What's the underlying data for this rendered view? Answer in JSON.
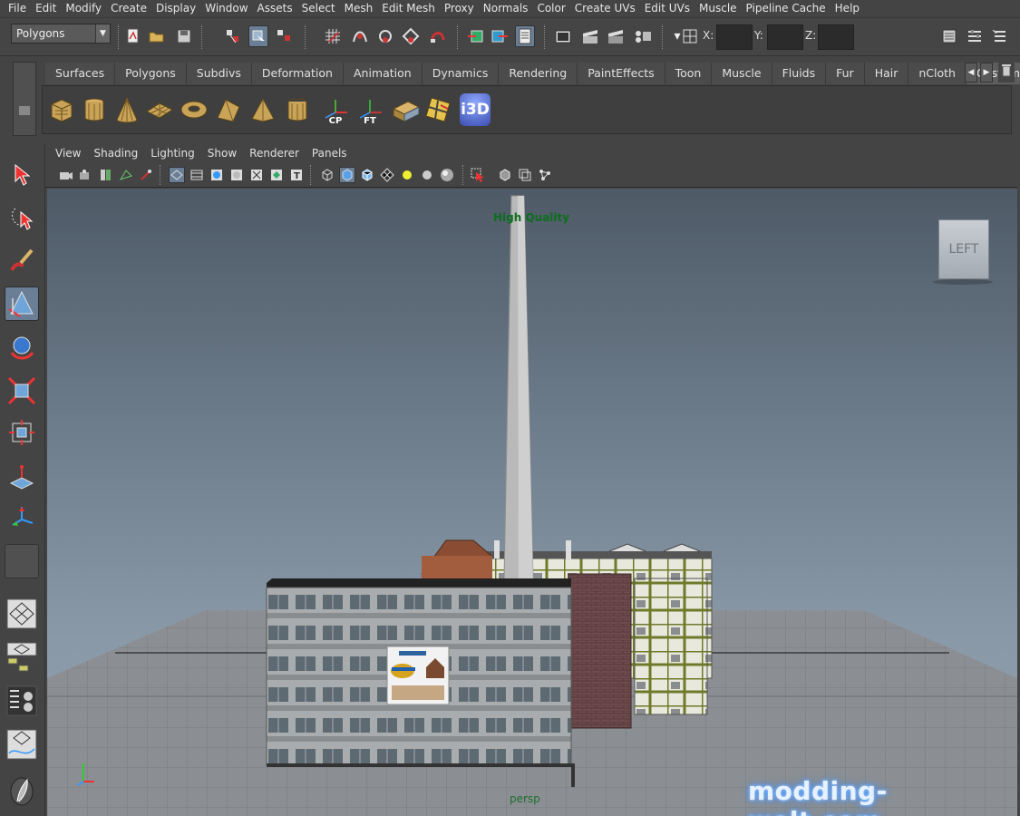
{
  "menubar": [
    "File",
    "Edit",
    "Modify",
    "Create",
    "Display",
    "Window",
    "Assets",
    "Select",
    "Mesh",
    "Edit Mesh",
    "Proxy",
    "Normals",
    "Color",
    "Create UVs",
    "Edit UVs",
    "Muscle",
    "Pipeline Cache",
    "Help"
  ],
  "statusline": {
    "mode": "Polygons",
    "x_label": "X:",
    "y_label": "Y:",
    "z_label": "Z:",
    "x_value": "",
    "y_value": "",
    "z_value": ""
  },
  "shelf": {
    "tabs": [
      "Surfaces",
      "Polygons",
      "Subdivs",
      "Deformation",
      "Animation",
      "Dynamics",
      "Rendering",
      "PaintEffects",
      "Toon",
      "Muscle",
      "Fluids",
      "Fur",
      "Hair",
      "nCloth",
      "Custom"
    ],
    "active_tab": "Custom",
    "tools": [
      {
        "name": "poly-cube-icon",
        "label": ""
      },
      {
        "name": "poly-cylinder-icon",
        "label": ""
      },
      {
        "name": "poly-cone-icon",
        "label": ""
      },
      {
        "name": "poly-plane-icon",
        "label": ""
      },
      {
        "name": "poly-torus-icon",
        "label": ""
      },
      {
        "name": "poly-prism-icon",
        "label": ""
      },
      {
        "name": "poly-pyramid-icon",
        "label": ""
      },
      {
        "name": "poly-pipe-icon",
        "label": ""
      },
      {
        "name": "center-pivot-icon",
        "label": "CP"
      },
      {
        "name": "freeze-transforms-icon",
        "label": "FT"
      },
      {
        "name": "uv-texture-icon",
        "label": ""
      },
      {
        "name": "uv-editor-icon",
        "label": ""
      },
      {
        "name": "i3d-export-icon",
        "label": "i3D"
      }
    ]
  },
  "panel": {
    "menus": [
      "View",
      "Shading",
      "Lighting",
      "Show",
      "Renderer",
      "Panels"
    ]
  },
  "viewport": {
    "quality_label": "High Quality",
    "view_cube_label": "LEFT",
    "camera_name": "persp",
    "sky_top": "#4e5a66",
    "sky_bottom": "#93a2b1"
  },
  "watermark": {
    "text_a": "modding",
    "text_b": "-welt.com"
  }
}
